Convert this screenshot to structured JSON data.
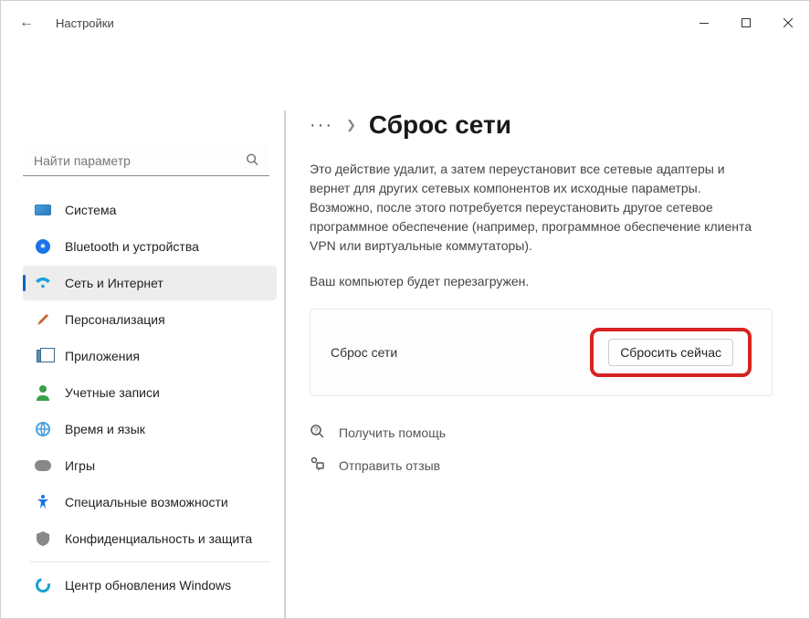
{
  "window": {
    "title": "Настройки"
  },
  "search": {
    "placeholder": "Найти параметр"
  },
  "sidebar": {
    "items": [
      {
        "label": "Система"
      },
      {
        "label": "Bluetooth и устройства"
      },
      {
        "label": "Сеть и Интернет"
      },
      {
        "label": "Персонализация"
      },
      {
        "label": "Приложения"
      },
      {
        "label": "Учетные записи"
      },
      {
        "label": "Время и язык"
      },
      {
        "label": "Игры"
      },
      {
        "label": "Специальные возможности"
      },
      {
        "label": "Конфиденциальность и защита"
      },
      {
        "label": "Центр обновления Windows"
      }
    ]
  },
  "main": {
    "page_title": "Сброс сети",
    "description": "Это действие удалит, а затем переустановит все сетевые адаптеры и вернет для других сетевых компонентов их исходные параметры. Возможно, после этого потребуется переустановить другое сетевое программное обеспечение (например, программное обеспечение клиента VPN или виртуальные коммутаторы).",
    "restart_note": "Ваш компьютер будет перезагружен.",
    "card_label": "Сброс сети",
    "reset_button": "Сбросить сейчас",
    "help_link": "Получить помощь",
    "feedback_link": "Отправить отзыв"
  }
}
